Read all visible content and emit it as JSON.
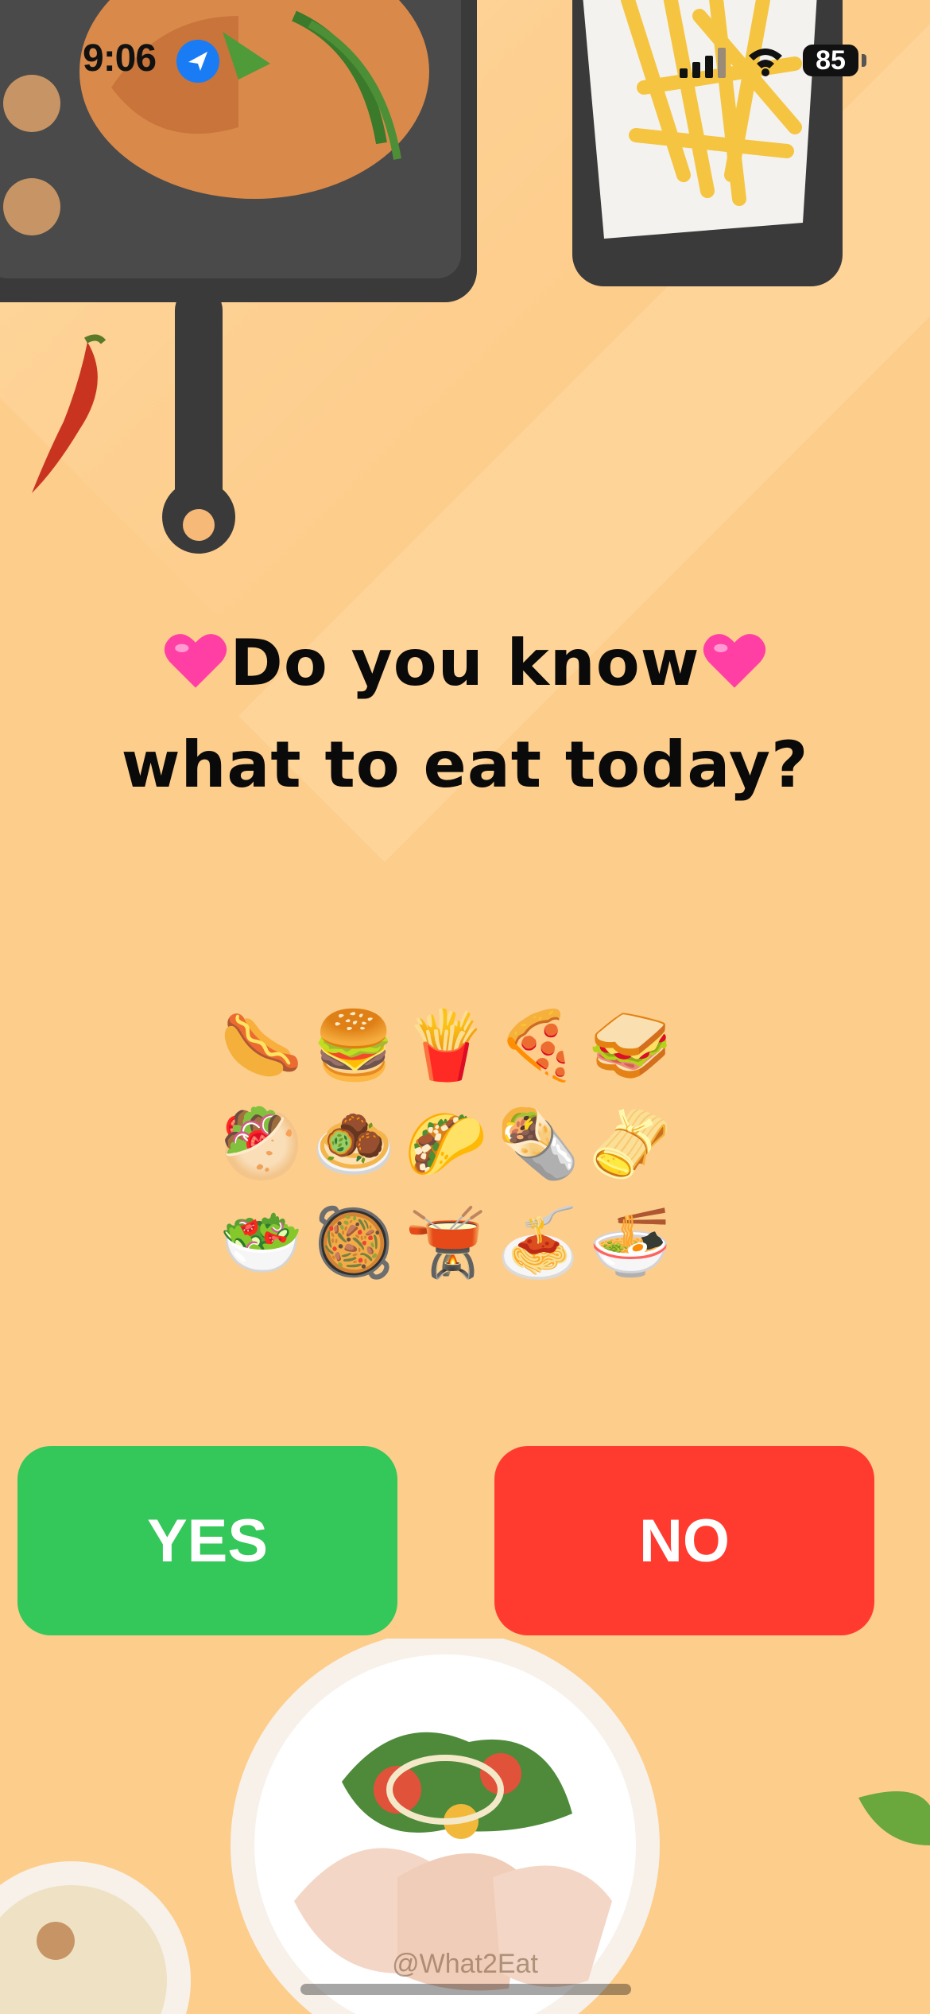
{
  "status_bar": {
    "time": "9:06",
    "battery": "85",
    "icons": [
      "location-arrow-icon",
      "signal-bars-icon",
      "wifi-icon",
      "battery-icon"
    ]
  },
  "heading": {
    "line1": "Do you know",
    "line2": "what to eat today?",
    "decor_icons": [
      "pink-heart-icon",
      "pink-heart-icon"
    ]
  },
  "emoji_grid": [
    {
      "name": "hot-dog",
      "glyph": "🌭"
    },
    {
      "name": "hamburger",
      "glyph": "🍔"
    },
    {
      "name": "french-fries",
      "glyph": "🍟"
    },
    {
      "name": "pizza",
      "glyph": "🍕"
    },
    {
      "name": "sandwich",
      "glyph": "🥪"
    },
    {
      "name": "stuffed-flatbread",
      "glyph": "🥙"
    },
    {
      "name": "falafel",
      "glyph": "🧆"
    },
    {
      "name": "taco",
      "glyph": "🌮"
    },
    {
      "name": "burrito",
      "glyph": "🌯"
    },
    {
      "name": "tamale",
      "glyph": "🫔"
    },
    {
      "name": "green-salad",
      "glyph": "🥗"
    },
    {
      "name": "shallow-pan-of-food",
      "glyph": "🥘"
    },
    {
      "name": "fondue",
      "glyph": "🫕"
    },
    {
      "name": "spaghetti",
      "glyph": "🍝"
    },
    {
      "name": "steaming-bowl",
      "glyph": "🍜"
    }
  ],
  "buttons": {
    "yes_label": "YES",
    "no_label": "NO",
    "yes_color": "#34c759",
    "no_color": "#ff3b30"
  },
  "watermark": "@What2Eat",
  "colors": {
    "background": "#fdcd8c",
    "heart": "#ff3fa4",
    "location": "#1a7cf5"
  }
}
